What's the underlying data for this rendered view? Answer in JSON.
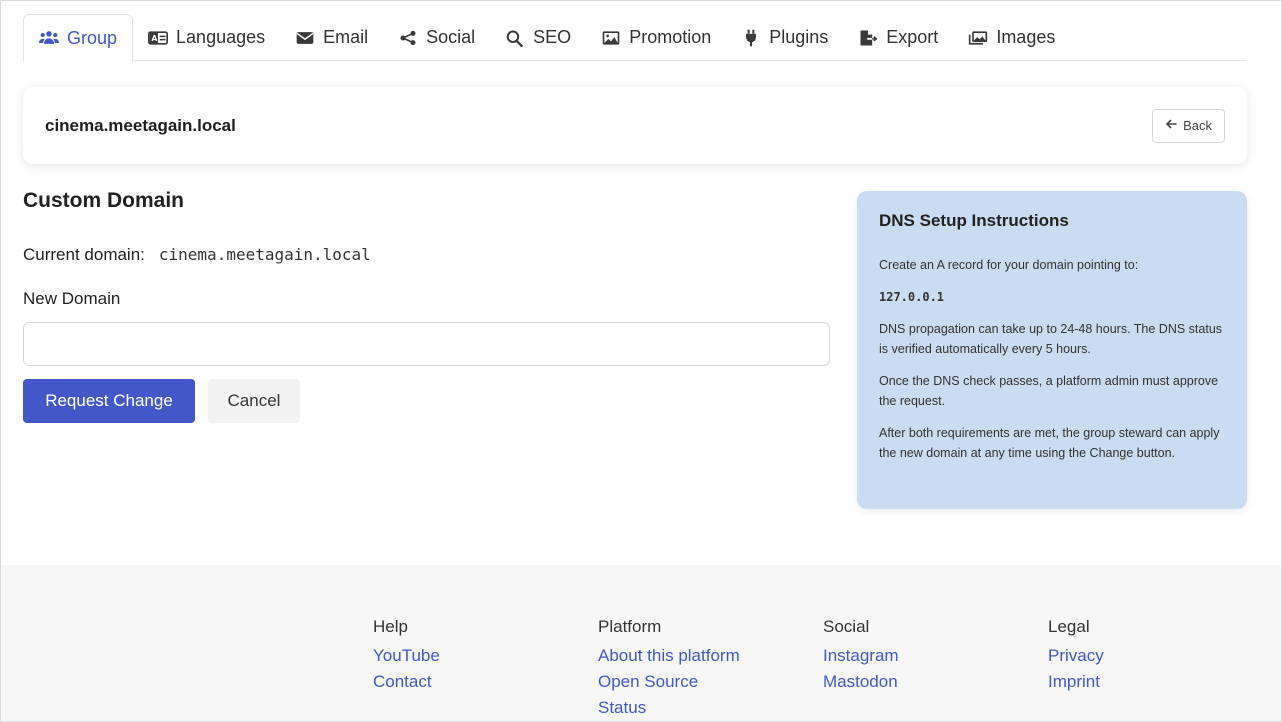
{
  "tabs": [
    {
      "label": "Group",
      "icon": "users-icon",
      "active": true
    },
    {
      "label": "Languages",
      "icon": "language-icon",
      "active": false
    },
    {
      "label": "Email",
      "icon": "envelope-icon",
      "active": false
    },
    {
      "label": "Social",
      "icon": "share-icon",
      "active": false
    },
    {
      "label": "SEO",
      "icon": "search-icon",
      "active": false
    },
    {
      "label": "Promotion",
      "icon": "image-icon",
      "active": false
    },
    {
      "label": "Plugins",
      "icon": "plug-icon",
      "active": false
    },
    {
      "label": "Export",
      "icon": "file-export-icon",
      "active": false
    },
    {
      "label": "Images",
      "icon": "images-icon",
      "active": false
    }
  ],
  "header": {
    "domain": "cinema.meetagain.local",
    "back_label": "Back"
  },
  "form": {
    "title": "Custom Domain",
    "current_label": "Current domain:",
    "current_value": "cinema.meetagain.local",
    "new_label": "New Domain",
    "new_value": "",
    "new_placeholder": "",
    "submit_label": "Request Change",
    "cancel_label": "Cancel"
  },
  "dns": {
    "title": "DNS Setup Instructions",
    "p1": "Create an A record for your domain pointing to:",
    "ip": "127.0.0.1",
    "p2": "DNS propagation can take up to 24-48 hours. The DNS status is verified automatically every 5 hours.",
    "p3": "Once the DNS check passes, a platform admin must approve the request.",
    "p4": "After both requirements are met, the group steward can apply the new domain at any time using the Change button."
  },
  "footer": {
    "help": {
      "title": "Help",
      "links": [
        "YouTube",
        "Contact"
      ]
    },
    "platform": {
      "title": "Platform",
      "links": [
        "About this platform",
        "Open Source",
        "Status"
      ]
    },
    "social": {
      "title": "Social",
      "links": [
        "Instagram",
        "Mastodon"
      ]
    },
    "legal": {
      "title": "Legal",
      "links": [
        "Privacy",
        "Imprint"
      ]
    }
  },
  "colors": {
    "accent": "#4357c9",
    "dns_card_bg": "#c9dcf2",
    "footer_bg": "#f7f7f7"
  }
}
